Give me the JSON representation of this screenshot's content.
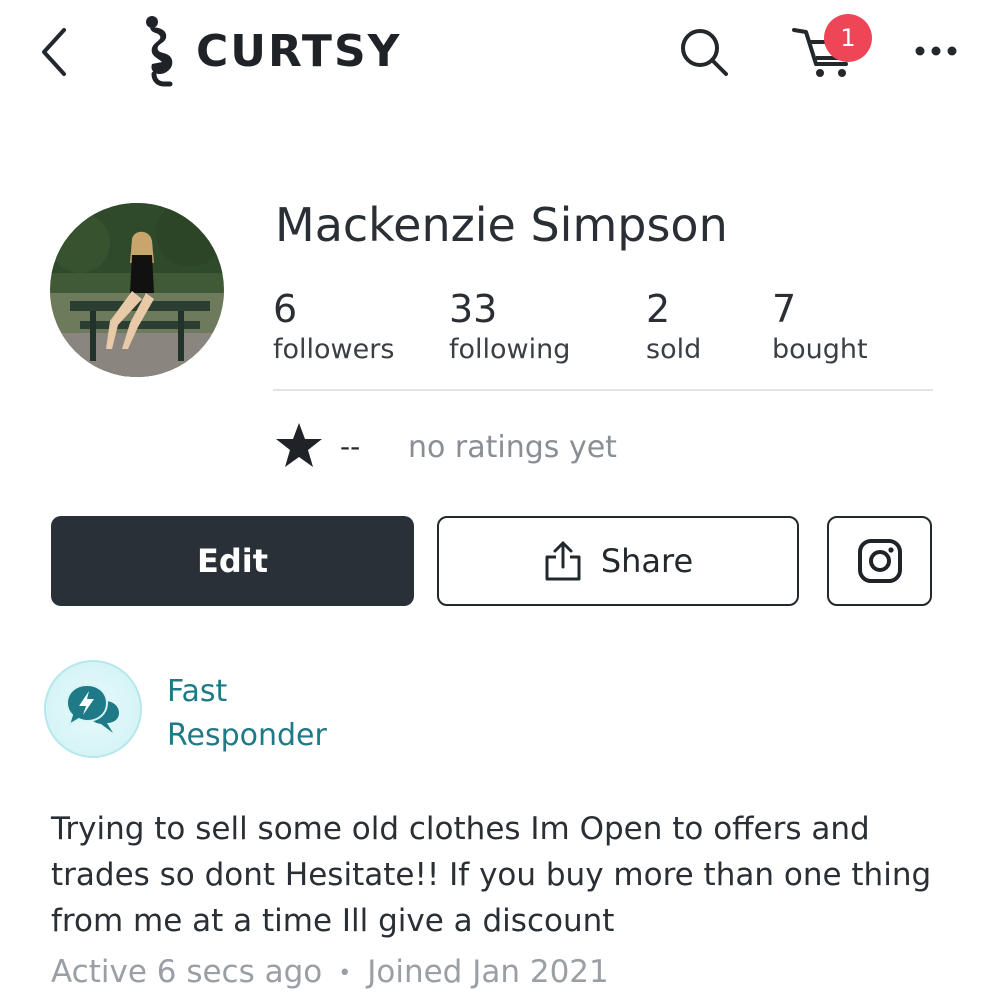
{
  "header": {
    "app_name": "CURTSY",
    "cart_count": "1",
    "icons": [
      "chevron-left-icon",
      "search-icon",
      "cart-icon",
      "more-icon"
    ]
  },
  "profile": {
    "name": "Mackenzie Simpson",
    "stats": [
      {
        "value": "6",
        "label": "followers"
      },
      {
        "value": "33",
        "label": "following"
      },
      {
        "value": "2",
        "label": "sold"
      },
      {
        "value": "7",
        "label": "bought"
      }
    ],
    "rating_value": "--",
    "rating_text": "no ratings yet"
  },
  "actions": {
    "edit_label": "Edit",
    "share_label": "Share"
  },
  "badge": {
    "line1": "Fast",
    "line2": "Responder",
    "icon": "chat-bolt-icon"
  },
  "bio": {
    "text": "Trying to sell some old clothes Im Open to offers and trades so dont Hesitate!! If you buy more than one thing from me at a time Ill give a discount",
    "active": "Active 6 secs ago",
    "separator": "•",
    "joined": "Joined Jan 2021"
  },
  "colors": {
    "primary_dark": "#2a3037",
    "badge_red": "#ee4557",
    "teal": "#1e7a86",
    "muted": "#9a9fa5"
  }
}
